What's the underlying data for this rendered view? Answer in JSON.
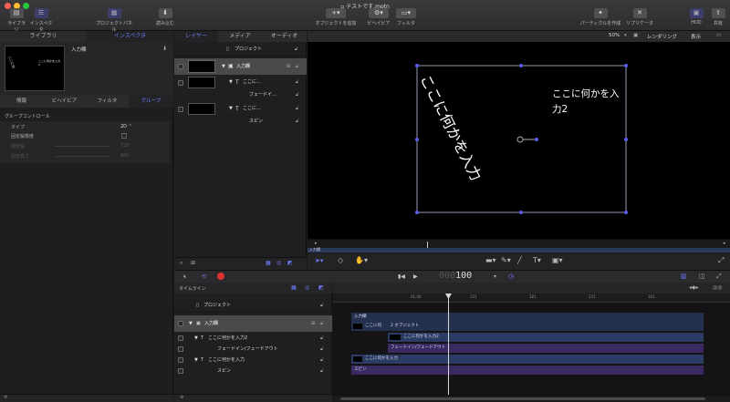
{
  "window": {
    "title": "テストです.motn"
  },
  "toolbar": {
    "left": [
      {
        "label": "ライブラリ",
        "icon": "library-icon"
      },
      {
        "label": "インスペクタ",
        "icon": "inspector-icon"
      },
      {
        "label": "プロジェクトパネル",
        "icon": "project-panel-icon"
      },
      {
        "label": "読み込む",
        "icon": "import-icon"
      }
    ],
    "center": [
      {
        "label": "オブジェクトを追加",
        "icon": "add-object-icon"
      },
      {
        "label": "ビヘイビア",
        "icon": "behaviors-icon"
      },
      {
        "label": "フィルタ",
        "icon": "filters-icon"
      }
    ],
    "right": [
      {
        "label": "パーティクルを作成",
        "icon": "particles-icon"
      },
      {
        "label": "リプリケータ",
        "icon": "replicator-icon"
      },
      {
        "label": "HUD",
        "icon": "hud-icon"
      },
      {
        "label": "共有",
        "icon": "share-icon"
      }
    ]
  },
  "left_panel": {
    "tabs": [
      "ライブラリ",
      "インスペクタ"
    ],
    "active_tab": "インスペクタ",
    "preview_title": "入力欄",
    "preview_text1": "ここに何",
    "preview_text2": "ここに何かを入力2",
    "sub_tabs": [
      "情報",
      "ビヘイビア",
      "フィルタ",
      "グループ"
    ],
    "active_sub_tab": "グループ",
    "section_title": "グループコントロール",
    "props": [
      {
        "label": "タイプ",
        "value": "2D ⌃"
      },
      {
        "label": "固定解像度",
        "value": ""
      },
      {
        "label": "固定幅",
        "value": "720"
      },
      {
        "label": "固定高さ",
        "value": "480"
      }
    ]
  },
  "layers_panel": {
    "tabs": [
      "レイヤー",
      "メディア",
      "オーディオ"
    ],
    "active_tab": "レイヤー",
    "project": "プロジェクト",
    "group": "入力欄",
    "layer1": "ここに…",
    "behavior1": "フェードイ…",
    "layer2": "ここに…",
    "behavior2": "スピン"
  },
  "canvas_bar": {
    "zoom": "50%",
    "render": "レンダリング",
    "view": "表示"
  },
  "canvas": {
    "rot_text": "ここに何かを入力",
    "text2_line1": "ここに何かを入",
    "text2_line2": "力2",
    "mini_label": "入力欄"
  },
  "transport": {
    "timecode": "100"
  },
  "timeline": {
    "label": "タイムライン",
    "rows": {
      "project": "プロジェクト",
      "group": "入力欄",
      "layer2": "ここに何かを入力2",
      "behavior_fade": "フェードイン/フェードアウト",
      "layer1": "ここに何かを入力",
      "behavior_spin": "スピン"
    },
    "ruler": [
      "01:00",
      "121",
      "181",
      "241",
      "301"
    ],
    "bars": {
      "group": "入力欄",
      "clip_a": "ここに何",
      "objects": "2 オブジェクト",
      "clip_b": "ここに何かを入力2",
      "fade": "フェードイン/フェードアウト",
      "clip_c": "ここに何かを入力",
      "spin": "スピン"
    }
  },
  "colors": {
    "accent": "#6f7cff",
    "handle": "#5a5df0"
  }
}
